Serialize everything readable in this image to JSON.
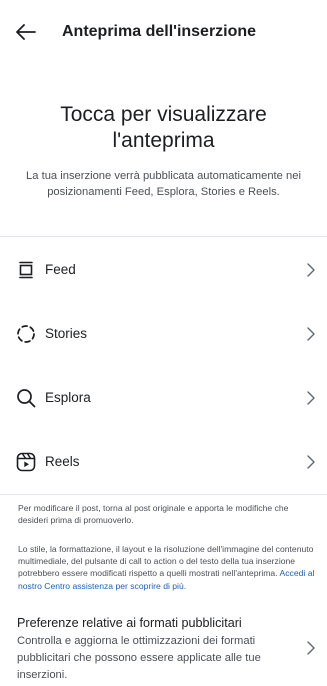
{
  "header": {
    "title": "Anteprima dell'inserzione"
  },
  "hero": {
    "title": "Tocca per visualizzare l'anteprima",
    "subtitle": "La tua inserzione verrà pubblicata automaticamente nei posizionamenti Feed, Esplora, Stories e Reels."
  },
  "placements": [
    {
      "label": "Feed",
      "icon": "feed-icon"
    },
    {
      "label": "Stories",
      "icon": "stories-icon"
    },
    {
      "label": "Esplora",
      "icon": "search-icon"
    },
    {
      "label": "Reels",
      "icon": "reels-icon"
    }
  ],
  "notes": {
    "edit_post": "Per modificare il post, torna al post originale e apporta le modifiche che desideri prima di promuoverlo.",
    "style_change": "Lo stile, la formattazione, il layout e la risoluzione dell'immagine del contenuto multimediale, del pulsante di call to action o del testo della tua inserzione potrebbero essere modificati rispetto a quelli mostrati nell'anteprima.",
    "help_link": "Accedi al nostro Centro assistenza per scoprire di più."
  },
  "preferences": {
    "title": "Preferenze relative ai formati pubblicitari",
    "description": "Controlla e aggiorna le ottimizzazioni dei formati pubblicitari che possono essere applicate alle tue inserzioni."
  },
  "colors": {
    "text": "#1c1e21",
    "secondary_text": "#4b4f56",
    "link": "#1d5fb8",
    "divider": "#e4e6eb"
  }
}
